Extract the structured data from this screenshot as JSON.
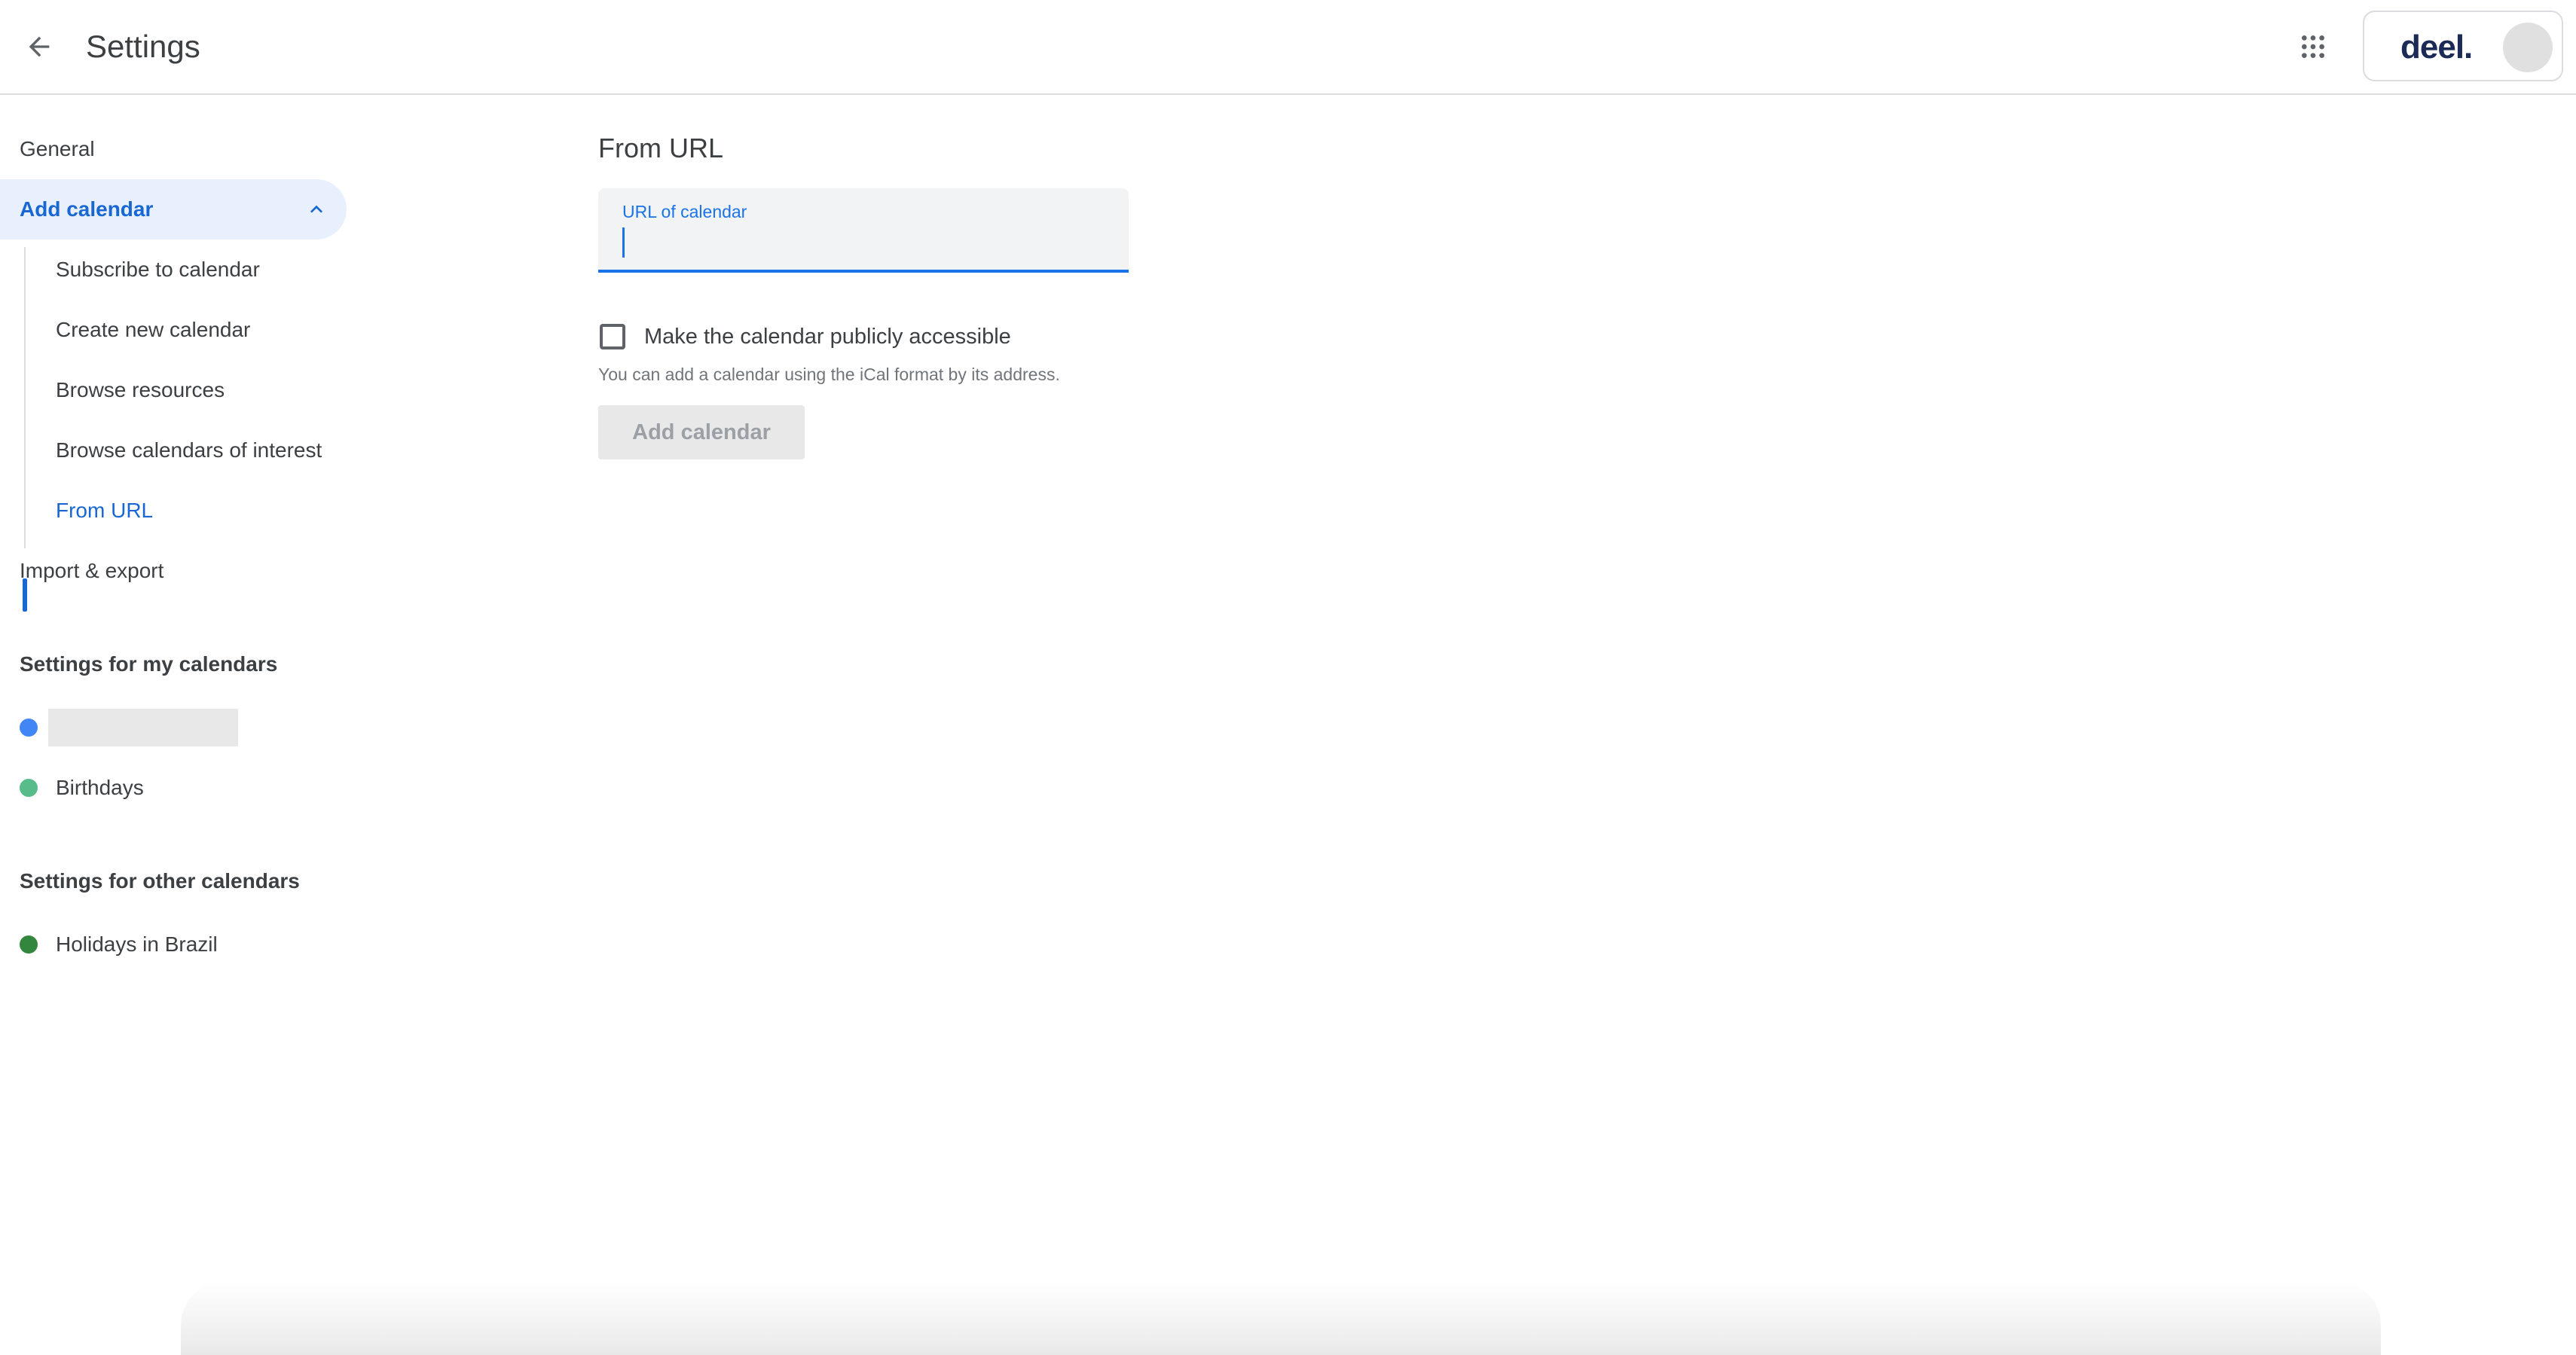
{
  "header": {
    "title": "Settings",
    "back_icon": "arrow-back-icon",
    "apps_icon": "apps-grid-icon",
    "org_logo_text": "deel."
  },
  "sidebar": {
    "top_items": [
      {
        "label": "General"
      },
      {
        "label": "Add calendar",
        "expanded": true
      }
    ],
    "add_calendar_subitems": [
      {
        "label": "Subscribe to calendar"
      },
      {
        "label": "Create new calendar"
      },
      {
        "label": "Browse resources"
      },
      {
        "label": "Browse calendars of interest"
      },
      {
        "label": "From URL",
        "selected": true
      }
    ],
    "import_export": {
      "label": "Import & export"
    },
    "my_calendars": {
      "heading": "Settings for my calendars",
      "items": [
        {
          "label": "",
          "color": "#4285f4",
          "redacted": true
        },
        {
          "label": "Birthdays",
          "color": "#57bb8a"
        }
      ]
    },
    "other_calendars": {
      "heading": "Settings for other calendars",
      "items": [
        {
          "label": "Holidays in Brazil",
          "color": "#33863e"
        }
      ]
    }
  },
  "main": {
    "title": "From URL",
    "url_field": {
      "label": "URL of calendar",
      "value": ""
    },
    "public_checkbox": {
      "label": "Make the calendar publicly accessible",
      "checked": false
    },
    "helper_text": "You can add a calendar using the iCal format by its address.",
    "add_button_label": "Add calendar"
  },
  "colors": {
    "accent": "#1a73e8",
    "active_nav_bg": "#e8f0fe",
    "active_nav_text": "#1967d2"
  }
}
